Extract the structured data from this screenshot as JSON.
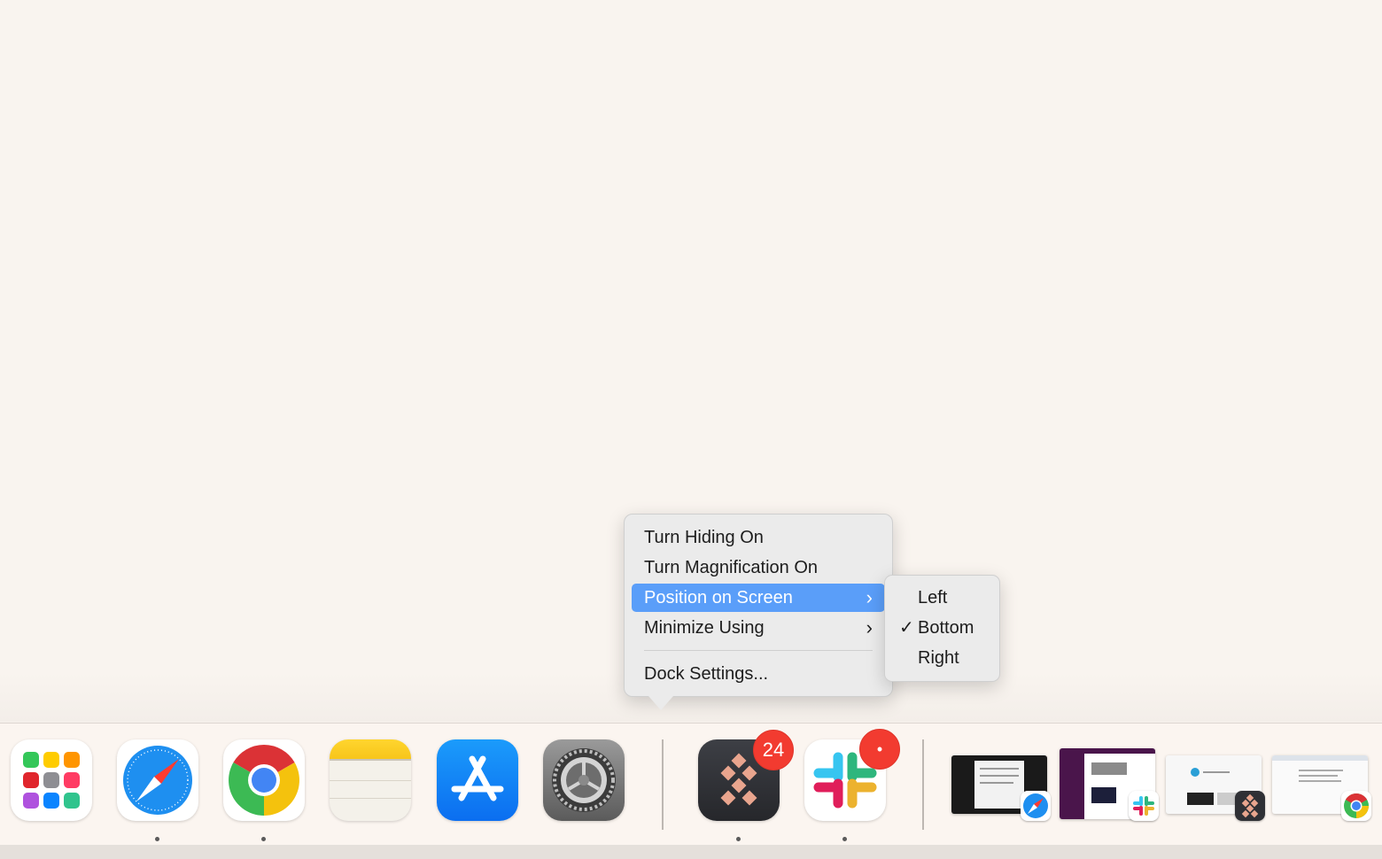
{
  "context_menu": {
    "items": [
      {
        "label": "Turn Hiding On"
      },
      {
        "label": "Turn Magnification On"
      },
      {
        "label": "Position on Screen",
        "chevron": "›"
      },
      {
        "label": "Minimize Using",
        "chevron": "›"
      },
      {
        "label": "Dock Settings..."
      }
    ],
    "selected_item": "Position on Screen"
  },
  "submenu": {
    "items": [
      {
        "label": "Left",
        "checked": false
      },
      {
        "label": "Bottom",
        "checked": true,
        "check": "✓"
      },
      {
        "label": "Right",
        "checked": false
      }
    ]
  },
  "dock": {
    "apps": [
      {
        "name": "Launchpad",
        "icon": "launchpad-icon",
        "running": false
      },
      {
        "name": "Safari",
        "icon": "safari-icon",
        "running": true
      },
      {
        "name": "Google Chrome",
        "icon": "chrome-icon",
        "running": true
      },
      {
        "name": "Notes",
        "icon": "notes-icon",
        "running": false
      },
      {
        "name": "App Store",
        "icon": "app-store-icon",
        "running": false
      },
      {
        "name": "System Settings",
        "icon": "system-settings-icon",
        "running": false
      },
      {
        "name": "Setapp",
        "icon": "setapp-icon",
        "running": true,
        "badge": "24"
      },
      {
        "name": "Slack",
        "icon": "slack-icon",
        "running": true,
        "badge": "•"
      }
    ],
    "minimized_windows": [
      {
        "app": "Safari",
        "icon": "safari-icon"
      },
      {
        "app": "Slack",
        "icon": "slack-icon"
      },
      {
        "app": "Setapp",
        "icon": "setapp-icon"
      },
      {
        "app": "Google Chrome",
        "icon": "chrome-icon"
      }
    ]
  },
  "colors": {
    "desktop": "#f9f4ef",
    "menu_highlight": "#5a9ef9",
    "badge": "#f23b30"
  }
}
